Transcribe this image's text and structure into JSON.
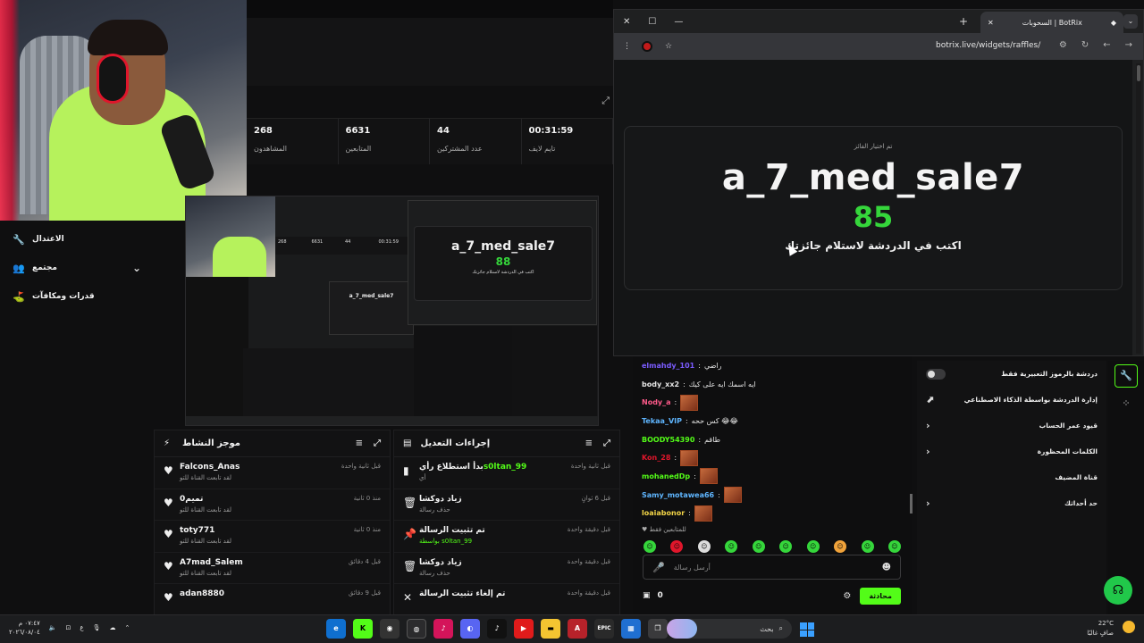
{
  "stats": [
    {
      "value": "268",
      "label": "المشاهدون"
    },
    {
      "value": "6631",
      "label": "المتابعين"
    },
    {
      "value": "44",
      "label": "عدد المشتركين"
    },
    {
      "value": "00:31:59",
      "label": "تايم لايف"
    }
  ],
  "nav": {
    "moderation": "الاعتدال",
    "community": "مجتمع",
    "rewards": "قدرات ومكافآت"
  },
  "preview": {
    "winner": "a_7_med_sale7",
    "number": "88",
    "message": "اكتب في الدردشة لاستلام جائزتك",
    "inner_winner": "a_7_med_sale7",
    "stats": [
      "268",
      "6631",
      "44",
      "00:31:59"
    ]
  },
  "activity": {
    "title": "موجز النشاط",
    "items": [
      {
        "name": "Falcons_Anas",
        "sub": "لقد تابعت القناة للتو",
        "time": "قبل ثانية واحدة"
      },
      {
        "name": "0تميم",
        "sub": "لقد تابعت القناة للتو",
        "time": "منذ 0 ثانية"
      },
      {
        "name": "toty771",
        "sub": "لقد تابعت القناة للتو",
        "time": "منذ 0 ثانية"
      },
      {
        "name": "A7mad_Salem",
        "sub": "لقد تابعت القناة للتو",
        "time": "قبل 4 دقائق"
      },
      {
        "name": "adan8880",
        "sub": "",
        "time": "قبل 9 دقائق"
      }
    ]
  },
  "modlog": {
    "title": "إجراءات التعديل",
    "items": [
      {
        "icon": "poll-icon",
        "glyph": "▮",
        "title": "بدأ استطلاع رأي",
        "user": "s0ltan_99",
        "sub": "أي",
        "time": "قبل ثانية واحدة"
      },
      {
        "icon": "trash-icon",
        "glyph": "🗑",
        "title": "زياد دوكشا",
        "user": "",
        "sub": "حذف رسالة",
        "time": "قبل 6 ثوانٍ"
      },
      {
        "icon": "pin-icon",
        "glyph": "📌",
        "title": "تم تثبيت الرسالة",
        "user": "",
        "sub": "بواسطة s0ltan_99",
        "time": "قبل دقيقة واحدة"
      },
      {
        "icon": "trash-icon",
        "glyph": "🗑",
        "title": "زياد دوكشا",
        "user": "",
        "sub": "حذف رسالة",
        "time": "قبل دقيقة واحدة"
      },
      {
        "icon": "unpin-icon",
        "glyph": "✕",
        "title": "تم إلغاء تثبيت الرسالة",
        "user": "",
        "sub": "",
        "time": "قبل دقيقة واحدة"
      }
    ]
  },
  "browser": {
    "tab_title": "السحوبات | BotRix",
    "url": "botrix.live/widgets/raffles/",
    "chosen_label": "تم اختيار الفائز",
    "winner": "a_7_med_sale7",
    "number": "85",
    "message": "اكتب في الدردشة لاستلام جائزتك"
  },
  "chat": {
    "messages": [
      {
        "user": "elmahdy_101",
        "color": "#7b5cff",
        "text": "راضي",
        "emote": false
      },
      {
        "user": "body_xx2",
        "color": "#e6e6e6",
        "text": "ايه اسمك ايه على كيك",
        "emote": false
      },
      {
        "user": "Nody_a",
        "color": "#ff5a8a",
        "text": "",
        "emote": true
      },
      {
        "user": "Tekaa_VIP",
        "color": "#5fb6ff",
        "text": "كس ححه 😂😂",
        "emote": false
      },
      {
        "user": "BOODY54390",
        "color": "#53fc18",
        "text": "طاقم",
        "emote": false
      },
      {
        "user": "Kon_28",
        "color": "#e0162b",
        "text": "",
        "emote": true
      },
      {
        "user": "mohanedDp",
        "color": "#53fc18",
        "text": "",
        "emote": true
      },
      {
        "user": "Samy_motawea66",
        "color": "#5fb6ff",
        "text": "",
        "emote": true
      },
      {
        "user": "loaiabonor",
        "color": "#f3d547",
        "text": "",
        "emote": true
      }
    ],
    "sub_only": "للمتابعين فقط",
    "placeholder": "أرسل رسالة",
    "points": "0",
    "send": "محادثة"
  },
  "settings": {
    "emote_only": "دردشة بالرموز التعبيرية فقط",
    "ai_chat": "إدارة الدردشة بواسطة الذكاء الاصطناعي",
    "account_age": "قيود عمر الحساب",
    "banned_words": "الكلمات المحظورة",
    "host": "قناة المضيف",
    "limits": "حد أحداثك"
  },
  "taskbar": {
    "time": "٠٧:٤٧ م",
    "date": "٢٠٢٦/٠٨/٠٤",
    "lang": "ع",
    "search": "بحث",
    "temp": "22°C",
    "weather": "صافٍ غالبًا",
    "epic": "EPIC"
  },
  "colors": {
    "accent": "#53fc18",
    "winner_number": "#35d63b"
  }
}
